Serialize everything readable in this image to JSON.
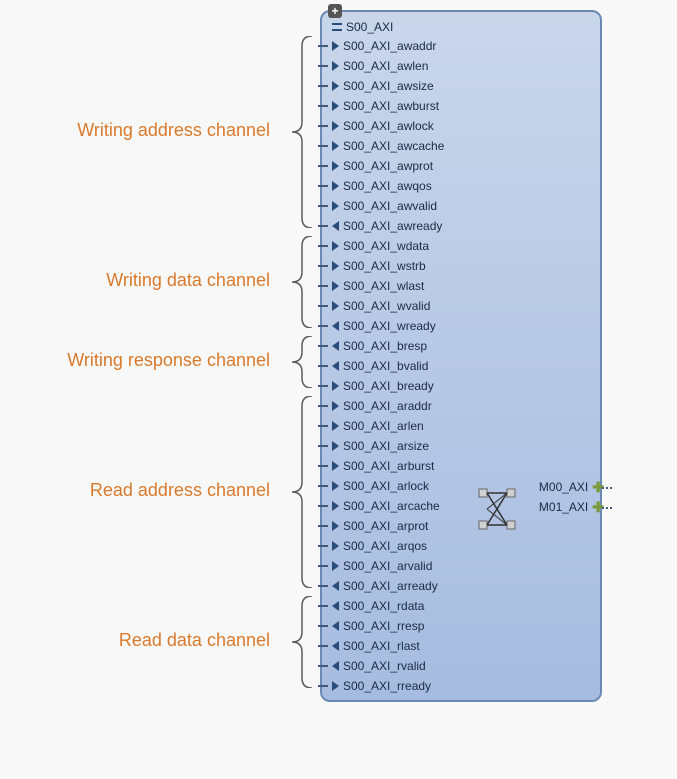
{
  "header": "S00_AXI",
  "channels": [
    {
      "label": "Writing address channel",
      "signals": [
        {
          "name": "S00_AXI_awaddr",
          "dir": "in"
        },
        {
          "name": "S00_AXI_awlen",
          "dir": "in"
        },
        {
          "name": "S00_AXI_awsize",
          "dir": "in"
        },
        {
          "name": "S00_AXI_awburst",
          "dir": "in"
        },
        {
          "name": "S00_AXI_awlock",
          "dir": "in"
        },
        {
          "name": "S00_AXI_awcache",
          "dir": "in"
        },
        {
          "name": "S00_AXI_awprot",
          "dir": "in"
        },
        {
          "name": "S00_AXI_awqos",
          "dir": "in"
        },
        {
          "name": "S00_AXI_awvalid",
          "dir": "in"
        },
        {
          "name": "S00_AXI_awready",
          "dir": "out"
        }
      ]
    },
    {
      "label": "Writing data channel",
      "signals": [
        {
          "name": "S00_AXI_wdata",
          "dir": "in"
        },
        {
          "name": "S00_AXI_wstrb",
          "dir": "in"
        },
        {
          "name": "S00_AXI_wlast",
          "dir": "in"
        },
        {
          "name": "S00_AXI_wvalid",
          "dir": "in"
        },
        {
          "name": "S00_AXI_wready",
          "dir": "out"
        }
      ]
    },
    {
      "label": "Writing response channel",
      "signals": [
        {
          "name": "S00_AXI_bresp",
          "dir": "out"
        },
        {
          "name": "S00_AXI_bvalid",
          "dir": "out"
        },
        {
          "name": "S00_AXI_bready",
          "dir": "in"
        }
      ]
    },
    {
      "label": "Read address channel",
      "signals": [
        {
          "name": "S00_AXI_araddr",
          "dir": "in"
        },
        {
          "name": "S00_AXI_arlen",
          "dir": "in"
        },
        {
          "name": "S00_AXI_arsize",
          "dir": "in"
        },
        {
          "name": "S00_AXI_arburst",
          "dir": "in"
        },
        {
          "name": "S00_AXI_arlock",
          "dir": "in"
        },
        {
          "name": "S00_AXI_arcache",
          "dir": "in"
        },
        {
          "name": "S00_AXI_arprot",
          "dir": "in"
        },
        {
          "name": "S00_AXI_arqos",
          "dir": "in"
        },
        {
          "name": "S00_AXI_arvalid",
          "dir": "in"
        },
        {
          "name": "S00_AXI_arready",
          "dir": "out"
        }
      ]
    },
    {
      "label": "Read data channel",
      "signals": [
        {
          "name": "S00_AXI_rdata",
          "dir": "out"
        },
        {
          "name": "S00_AXI_rresp",
          "dir": "out"
        },
        {
          "name": "S00_AXI_rlast",
          "dir": "out"
        },
        {
          "name": "S00_AXI_rvalid",
          "dir": "out"
        },
        {
          "name": "S00_AXI_rready",
          "dir": "in"
        }
      ]
    }
  ],
  "masters": [
    {
      "name": "M00_AXI"
    },
    {
      "name": "M01_AXI"
    }
  ]
}
